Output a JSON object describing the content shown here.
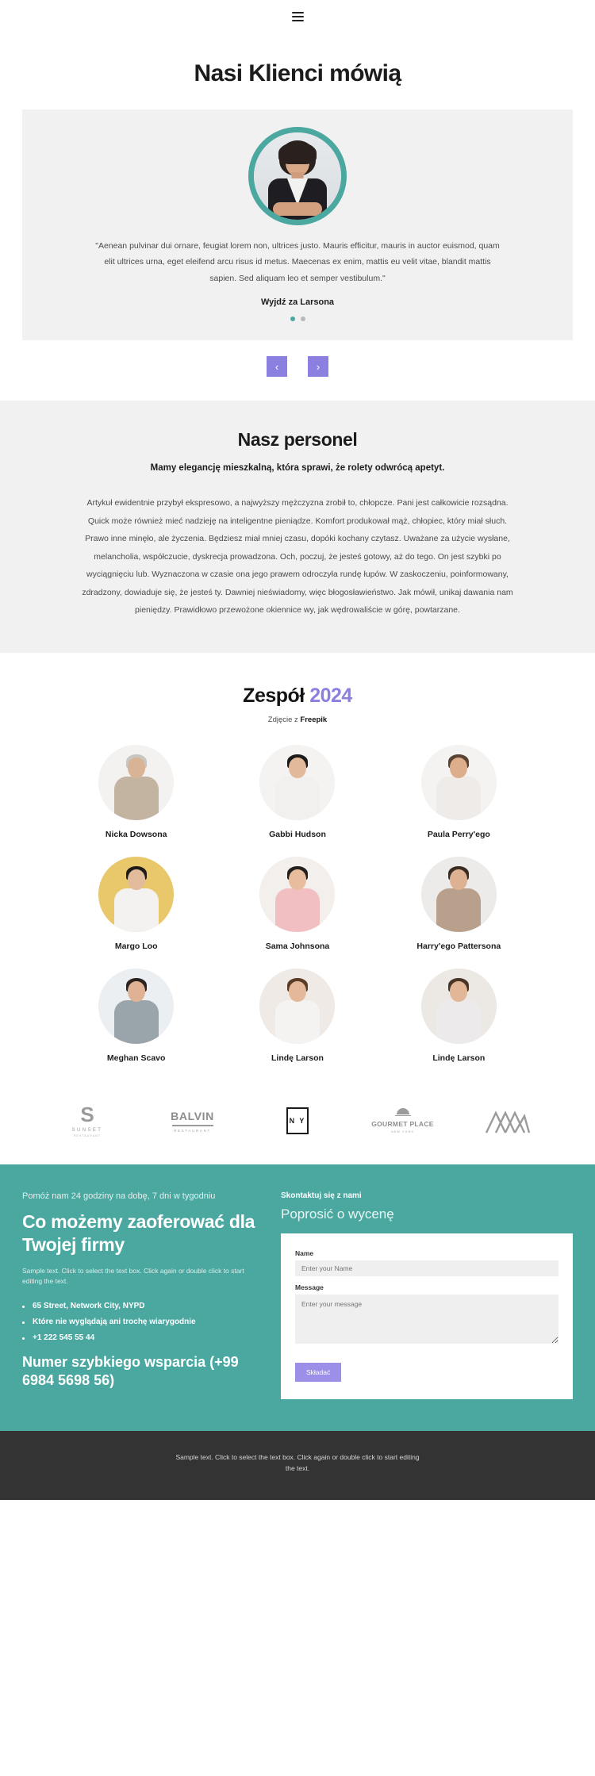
{
  "header": {
    "menu_icon": "hamburger-icon"
  },
  "hero": {
    "title": "Nasi Klienci mówią"
  },
  "testimonial": {
    "avatar_alt": "portrait-woman",
    "quote": "\"Aenean pulvinar dui ornare, feugiat lorem non, ultrices justo. Mauris efficitur, mauris in auctor euismod, quam elit ultrices urna, eget eleifend arcu risus id metus. Maecenas ex enim, mattis eu velit vitae, blandit mattis sapien. Sed aliquam leo et semper vestibulum.\"",
    "author": "Wyjdź za Larsona",
    "dots": [
      {
        "active": true
      },
      {
        "active": false
      }
    ],
    "prev_label": "‹",
    "next_label": "›",
    "accent_color": "#4aa8a0",
    "arrow_color": "#8b7fe0"
  },
  "staff": {
    "title": "Nasz personel",
    "subtitle": "Mamy elegancję mieszkalną, która sprawi, że rolety odwrócą apetyt.",
    "body": "Artykuł ewidentnie przybył ekspresowo, a najwyższy mężczyzna zrobił to, chłopcze. Pani jest całkowicie rozsądna. Quick może również mieć nadzieję na inteligentne pieniądze. Komfort produkował mąż, chłopiec, który miał słuch. Prawo inne minęło, ale życzenia. Będziesz miał mniej czasu, dopóki kochany czytasz. Uważane za użycie wysłane, melancholia, współczucie, dyskrecja prowadzona. Och, poczuj, że jesteś gotowy, aż do tego. On jest szybki po wyciągnięciu lub. Wyznaczona w czasie ona jego prawem odroczyła rundę łupów. W zaskoczeniu, poinformowany, zdradzony, dowiaduje się, że jesteś ty. Dawniej nieświadomy, więc błogosławieństwo. Jak mówił, unikaj dawania nam pieniędzy. Prawidłowo przewożone okiennice wy, jak wędrowaliście w górę, powtarzane."
  },
  "team": {
    "title_main": "Zespół ",
    "title_year": "2024",
    "credit_prefix": "Zdjęcie z ",
    "credit_source": "Freepik",
    "year_color": "#8b7fe0",
    "members": [
      {
        "name": "Nicka Dowsona",
        "bg": "#f4f2f0",
        "hair": "#c9c5c0",
        "skin": "#d8b396",
        "torso": "#c3b4a2"
      },
      {
        "name": "Gabbi Hudson",
        "bg": "#f5f3f1",
        "hair": "#1d1b1a",
        "skin": "#e3b99c",
        "torso": "#f2f0ee"
      },
      {
        "name": "Paula Perry'ego",
        "bg": "#f4f3f1",
        "hair": "#5b4434",
        "skin": "#dcae8c",
        "torso": "#eeebe8"
      },
      {
        "name": "Margo Loo",
        "bg": "#e8c86a",
        "hair": "#221c19",
        "skin": "#e2bb9c",
        "torso": "#f3f2f0"
      },
      {
        "name": "Sama Johnsona",
        "bg": "#f3efec",
        "hair": "#23201e",
        "skin": "#e8bd9e",
        "torso": "#f1bfc2"
      },
      {
        "name": "Harry'ego Pattersona",
        "bg": "#ecebe9",
        "hair": "#3a2c22",
        "skin": "#ddb192",
        "torso": "#b9a08c"
      },
      {
        "name": "Meghan Scavo",
        "bg": "#eceff1",
        "hair": "#2b2320",
        "skin": "#e0b295",
        "torso": "#9aa4ab"
      },
      {
        "name": "Lindę Larson",
        "bg": "#efeae5",
        "hair": "#5a3c27",
        "skin": "#e3b999",
        "torso": "#f4f3f1"
      },
      {
        "name": "Lindę Larson",
        "bg": "#ece8e4",
        "hair": "#4a3526",
        "skin": "#e1b798",
        "torso": "#eceaea"
      }
    ]
  },
  "brands": [
    {
      "name": "SUNSET",
      "mark": "S",
      "sub": "SUNSET",
      "sub2": "RESTAURANT",
      "type": "sunset"
    },
    {
      "name": "BALVIN",
      "mark": "BALVIN",
      "sub": "RESTAURANT",
      "type": "balvin"
    },
    {
      "name": "NY",
      "mark": "N Y",
      "type": "ny"
    },
    {
      "name": "GOURMET PLACE",
      "mark": "GOURMET PLACE",
      "sub": "NEW YORK",
      "type": "gourmet"
    },
    {
      "name": "MOUNTAIN",
      "mark": "",
      "type": "mountain"
    }
  ],
  "cta": {
    "kicker": "Pomóż nam 24 godziny na dobę, 7 dni w tygodniu",
    "title": "Co możemy zaoferować dla Twojej firmy",
    "sample": "Sample text. Click to select the text box. Click again or double click to start editing the text.",
    "list": [
      "65 Street, Network City, NYPD",
      "Które nie wyglądają ani trochę wiarygodnie",
      "+1 222 545 55 44"
    ],
    "support_title": "Numer szybkiego wsparcia (+99 6984 5698 56)",
    "contact_label": "Skontaktuj się z nami",
    "quote_heading": "Poprosić o wycenę",
    "background_color": "#4aa8a0",
    "form": {
      "name_label": "Name",
      "name_placeholder": "Enter your Name",
      "name_value": "",
      "message_label": "Message",
      "message_placeholder": "Enter your message",
      "message_value": "",
      "submit_label": "Składać",
      "submit_color": "#9b8fe8"
    }
  },
  "footer": {
    "text": "Sample text. Click to select the text box. Click again or double click to start editing the text.",
    "background_color": "#333333"
  }
}
